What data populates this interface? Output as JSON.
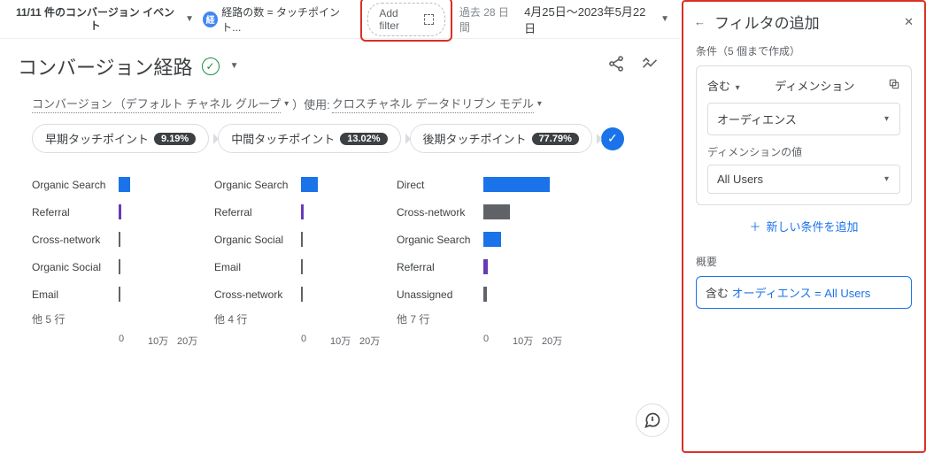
{
  "header": {
    "event_count": "11/11 件のコンバージョン イベント",
    "metric_chip_icon": "経",
    "metric_chip": "経路の数 = タッチポイント...",
    "add_filter": "Add filter",
    "range_prefix": "過去 28 日間",
    "date_range": "4月25日～2023年5月22日"
  },
  "title": "コンバージョン経路",
  "subtext": {
    "w1": "コンバージョン",
    "w2": "（デフォルト チャネル グループ",
    "w3": "）使用: ",
    "w4": "クロスチャネル データドリブン モデル"
  },
  "tabs": [
    {
      "label": "早期タッチポイント",
      "pct": "9.19%"
    },
    {
      "label": "中間タッチポイント",
      "pct": "13.02%"
    },
    {
      "label": "後期タッチポイント",
      "pct": "77.79%"
    }
  ],
  "axis_ticks": [
    "0",
    "10万",
    "20万"
  ],
  "axis_max": 200000,
  "colors": {
    "c0": "#1a73e8",
    "c1": "#5f6368",
    "c2": "#673ab7"
  },
  "chart_data": [
    {
      "type": "bar",
      "title": "早期タッチポイント",
      "xlabel": "",
      "ylabel": "",
      "ylim": [
        0,
        200000
      ],
      "series": [
        {
          "name": "Organic Search",
          "value": 25000,
          "colorKey": "c0"
        },
        {
          "name": "Referral",
          "value": 5000,
          "colorKey": "c2"
        },
        {
          "name": "Cross-network",
          "value": 4000,
          "colorKey": "c1"
        },
        {
          "name": "Organic Social",
          "value": 3000,
          "colorKey": "c1"
        },
        {
          "name": "Email",
          "value": 1500,
          "colorKey": "c1"
        }
      ],
      "other": "他 5 行"
    },
    {
      "type": "bar",
      "title": "中間タッチポイント",
      "xlabel": "",
      "ylabel": "",
      "ylim": [
        0,
        200000
      ],
      "series": [
        {
          "name": "Organic Search",
          "value": 38000,
          "colorKey": "c0"
        },
        {
          "name": "Referral",
          "value": 6000,
          "colorKey": "c2"
        },
        {
          "name": "Organic Social",
          "value": 3000,
          "colorKey": "c1"
        },
        {
          "name": "Email",
          "value": 1500,
          "colorKey": "c1"
        },
        {
          "name": "Cross-network",
          "value": 1200,
          "colorKey": "c1"
        }
      ],
      "other": "他 4 行"
    },
    {
      "type": "bar",
      "title": "後期タッチポイント",
      "xlabel": "",
      "ylabel": "",
      "ylim": [
        0,
        200000
      ],
      "series": [
        {
          "name": "Direct",
          "value": 150000,
          "colorKey": "c0"
        },
        {
          "name": "Cross-network",
          "value": 60000,
          "colorKey": "c1"
        },
        {
          "name": "Organic Search",
          "value": 40000,
          "colorKey": "c0"
        },
        {
          "name": "Referral",
          "value": 10000,
          "colorKey": "c2"
        },
        {
          "name": "Unassigned",
          "value": 8000,
          "colorKey": "c1"
        }
      ],
      "other": "他 7 行"
    }
  ],
  "panel": {
    "title": "フィルタの追加",
    "cond_header": "条件（5 個まで作成）",
    "include": "含む",
    "dimension_label": "ディメンション",
    "dimension_value": "オーディエンス",
    "dim_value_label": "ディメンションの値",
    "dim_value": "All Users",
    "add_new": "新しい条件を追加",
    "summary_label": "概要",
    "summary_k": "含む",
    "summary_v": "オーディエンス = All Users"
  }
}
